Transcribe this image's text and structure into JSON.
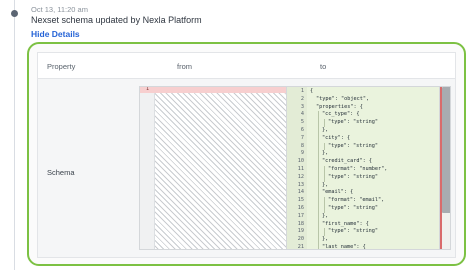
{
  "event": {
    "timestamp": "Oct 13, 11:20 am",
    "title": "Nexset schema updated by Nexla Platform",
    "hide_details_label": "Hide Details"
  },
  "table": {
    "columns": [
      "Property",
      "from",
      "to"
    ],
    "rows": [
      {
        "property": "Schema"
      }
    ]
  },
  "diff": {
    "from_lines": [
      {
        "num": "1",
        "text": ""
      }
    ],
    "to_lines": [
      {
        "num": "1",
        "indent": 0,
        "text": "{"
      },
      {
        "num": "2",
        "indent": 1,
        "text": "\"type\": \"object\","
      },
      {
        "num": "3",
        "indent": 1,
        "text": "\"properties\": {"
      },
      {
        "num": "4",
        "indent": 2,
        "text": "\"cc_type\": {"
      },
      {
        "num": "5",
        "indent": 3,
        "text": "\"type\": \"string\""
      },
      {
        "num": "6",
        "indent": 2,
        "text": "},"
      },
      {
        "num": "7",
        "indent": 2,
        "text": "\"city\": {"
      },
      {
        "num": "8",
        "indent": 3,
        "text": "\"type\": \"string\""
      },
      {
        "num": "9",
        "indent": 2,
        "text": "},"
      },
      {
        "num": "10",
        "indent": 2,
        "text": "\"credit_card\": {"
      },
      {
        "num": "11",
        "indent": 3,
        "text": "\"format\": \"number\","
      },
      {
        "num": "12",
        "indent": 3,
        "text": "\"type\": \"string\""
      },
      {
        "num": "13",
        "indent": 2,
        "text": "},"
      },
      {
        "num": "14",
        "indent": 2,
        "text": "\"email\": {"
      },
      {
        "num": "15",
        "indent": 3,
        "text": "\"format\": \"email\","
      },
      {
        "num": "16",
        "indent": 3,
        "text": "\"type\": \"string\""
      },
      {
        "num": "17",
        "indent": 2,
        "text": "},"
      },
      {
        "num": "18",
        "indent": 2,
        "text": "\"first_name\": {"
      },
      {
        "num": "19",
        "indent": 3,
        "text": "\"type\": \"string\""
      },
      {
        "num": "20",
        "indent": 2,
        "text": "},"
      },
      {
        "num": "21",
        "indent": 2,
        "text": "\"last_name\": {"
      }
    ]
  },
  "colors": {
    "accent_border": "#7cc143",
    "link": "#2563d6",
    "removed_bg": "#f7cfcf",
    "added_bg": "#eaf3dd"
  }
}
